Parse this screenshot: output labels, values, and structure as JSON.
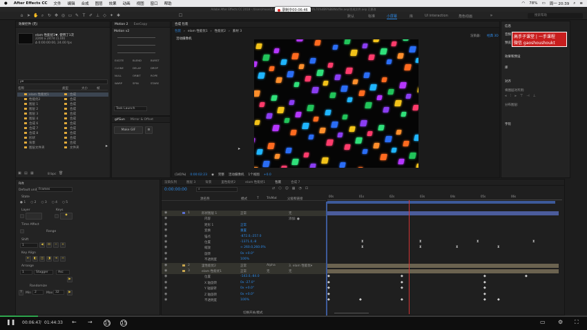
{
  "mac_menu": {
    "app_name": "After Effects CC",
    "items": [
      "文件",
      "编辑",
      "合成",
      "图层",
      "效果",
      "动画",
      "视图",
      "窗口",
      "帮助"
    ],
    "battery": "78%",
    "clock": "周一 20:39"
  },
  "window": {
    "title": "Adobe After Effects CC 2018 - /Users/moon/Library/C... sign/2018/wb/%24%76%4B9%B8Wo/file.aep/合成文件.aep 已更改",
    "recording_label": "录制中00:06:46"
  },
  "workspaces": [
    "默认",
    "标准",
    "小屏幕",
    "库",
    "UI interaction",
    "角色动画"
  ],
  "active_workspace": "小屏幕",
  "help_search_placeholder": "搜索帮助",
  "project_panel": {
    "tab": "效果控件 (无)",
    "comp_name": "elam 性能优1▼, 使用了1次",
    "comp_info_1": "2200 x 2474 (1.00)",
    "comp_info_2": "Δ 0:00:00:00, 24.00 fps",
    "search_placeholder": "ρ▾",
    "columns": [
      "名称",
      "类型",
      "大小",
      "帧"
    ],
    "rows": [
      {
        "name": "elam 性能优1",
        "type": "合成",
        "color": "#e0a93a",
        "selected": true
      },
      {
        "name": "性能优2",
        "type": "合成",
        "color": "#e0a93a"
      },
      {
        "name": "图层 1",
        "type": "合成",
        "color": "#e0a93a"
      },
      {
        "name": "图层 2",
        "type": "合成",
        "color": "#e0a93a"
      },
      {
        "name": "图层 3",
        "type": "合成",
        "color": "#e0a93a"
      },
      {
        "name": "图层 4",
        "type": "合成",
        "color": "#e0a93a"
      },
      {
        "name": "合成 6",
        "type": "合成",
        "color": "#e0a93a"
      },
      {
        "name": "合成 7",
        "type": "合成",
        "color": "#e0a93a"
      },
      {
        "name": "合成 8",
        "type": "合成",
        "color": "#e0a93a"
      },
      {
        "name": "形状",
        "type": "合成",
        "color": "#e0a93a"
      },
      {
        "name": "背景",
        "type": "合成",
        "color": "#e0a93a"
      },
      {
        "name": "图层文件夹",
        "type": "文件夹",
        "color": "#e0a93a"
      }
    ],
    "footer_bpc": "8 bpc"
  },
  "motion_panel": {
    "tabs": [
      "Motion 2",
      "ExeCopy"
    ],
    "version": "Motion v2",
    "buttons": [
      "EXCITE",
      "BLEND",
      "BURST",
      "CLONE",
      "DELAY",
      "DROP",
      "NULL",
      "ORBIT",
      "ROPE",
      "WARP",
      "SPIN",
      "STARE"
    ],
    "task": "Task Launch"
  },
  "gifgun_panel": {
    "tabs": [
      "gifGun",
      "Mirror & Offset"
    ],
    "make_gif": "Make GIF"
  },
  "comp_panel": {
    "tab": "合成 包装",
    "breadcrumbs": [
      "包装",
      "elam 性能优1",
      "性能优2",
      "素材 3"
    ],
    "camera_label": "活动摄像机",
    "renderer_label": "渲染器:",
    "renderer_value": "经典 3D",
    "footer_zoom": "(141%)",
    "footer_time": "0:00:02:23",
    "footer_quality": "完整",
    "footer_camera": "活动摄像机",
    "footer_views": "1个视图",
    "footer_offset": "+0.0"
  },
  "right_panels": {
    "info": "信息",
    "audio": "音频",
    "preview": "预览",
    "effects_presets": "效果和预设",
    "library": "库",
    "align": "对齐",
    "align_to": "将图层对齐到:",
    "distribute": "分布图层:",
    "character": "字符"
  },
  "promo": {
    "line1": "高手子课堂 | 一手课程",
    "line2": "微信 gaoshoushoukt"
  },
  "timeline": {
    "tabs": [
      "渲染队列",
      "图层 3",
      "背景",
      "里性能优2",
      "elam 性能优1",
      "包装",
      "合成 7"
    ],
    "active_tab": "包装",
    "current_time": "0:00:00:00",
    "columns": [
      "源名称",
      "模式",
      "T",
      "TrkMat",
      "父级和链接"
    ],
    "layers": [
      {
        "num": "1",
        "name": "形状图层 1",
        "mode": "正常",
        "trkmat": "",
        "parent": "无",
        "color": "#5a6fd0"
      },
      {
        "num": "",
        "name": "内容",
        "mode": "",
        "trkmat": "",
        "parent": "添加: ●"
      },
      {
        "num": "",
        "name": "矩形 1",
        "mode": "正常",
        "trkmat": "",
        "parent": ""
      },
      {
        "num": "",
        "name": "变换",
        "mode": "重置",
        "trkmat": "",
        "parent": ""
      },
      {
        "num": "",
        "name": "锚点",
        "mode": "-872.0,-257.0",
        "trkmat": "",
        "parent": ""
      },
      {
        "num": "",
        "name": "位置",
        "mode": "-1371.0,-8",
        "trkmat": "",
        "parent": ""
      },
      {
        "num": "",
        "name": "缩放",
        "mode": "∞ 260.0,260.0%",
        "trkmat": "",
        "parent": ""
      },
      {
        "num": "",
        "name": "旋转",
        "mode": "0x +0.0°",
        "trkmat": "",
        "parent": ""
      },
      {
        "num": "",
        "name": "不透明度",
        "mode": "100%",
        "trkmat": "",
        "parent": ""
      },
      {
        "num": "2",
        "name": "里性能优2",
        "mode": "正常",
        "trkmat": "Alpha",
        "parent": "3. elam 性能优▾",
        "color": "#c7a54e"
      },
      {
        "num": "3",
        "name": "elam 性能优1",
        "mode": "正常",
        "trkmat": "无",
        "parent": "无",
        "color": "#c7a54e"
      },
      {
        "num": "",
        "name": "位置",
        "mode": "-143.0,-84.0",
        "trkmat": "",
        "parent": ""
      },
      {
        "num": "",
        "name": "X 轴旋转",
        "mode": "0x -27.0°",
        "trkmat": "",
        "parent": ""
      },
      {
        "num": "",
        "name": "Y 轴旋转",
        "mode": "0x +0.0°",
        "trkmat": "",
        "parent": ""
      },
      {
        "num": "",
        "name": "Z 轴旋转",
        "mode": "0x +0.0°",
        "trkmat": "",
        "parent": ""
      },
      {
        "num": "",
        "name": "不透明度",
        "mode": "100%",
        "trkmat": "",
        "parent": ""
      }
    ],
    "ruler": [
      "00s",
      "01s",
      "02s",
      "03s",
      "04s",
      "05s",
      "06s"
    ],
    "footer_label": "切换开关/模式"
  },
  "rift_panel": {
    "title": "Rift",
    "default_unit_label": "Default unit:",
    "default_unit_value": "Frames",
    "state_label": "State",
    "state_options": [
      "1",
      "2",
      "3",
      "4",
      "5"
    ],
    "layer_label": "Layer",
    "keys_label": "Keys",
    "time_affect_label": "Time Affect",
    "range_label": "Range",
    "shift_label": "Shift",
    "shift_value": "1",
    "key_align_label": "Key Align",
    "arrange_label": "Arrange",
    "arrange_value": "1",
    "arrange_mode": "Stagger",
    "arrange_order": "Asc",
    "randomize_label": "Randomize",
    "min_label": "Min",
    "min_value": "2",
    "max_label": "Max",
    "max_value": "32"
  },
  "player": {
    "elapsed": "00:06:47",
    "total": "01:44:33",
    "progress": 0.065,
    "skip_back": "15",
    "skip_fwd": "15"
  },
  "colors": {
    "accent_blue": "#2d8ceb",
    "playhead_red": "#d33434",
    "record_red": "#e02626",
    "label_yellow": "#e0a93a",
    "progress_green": "#2fa84f"
  }
}
